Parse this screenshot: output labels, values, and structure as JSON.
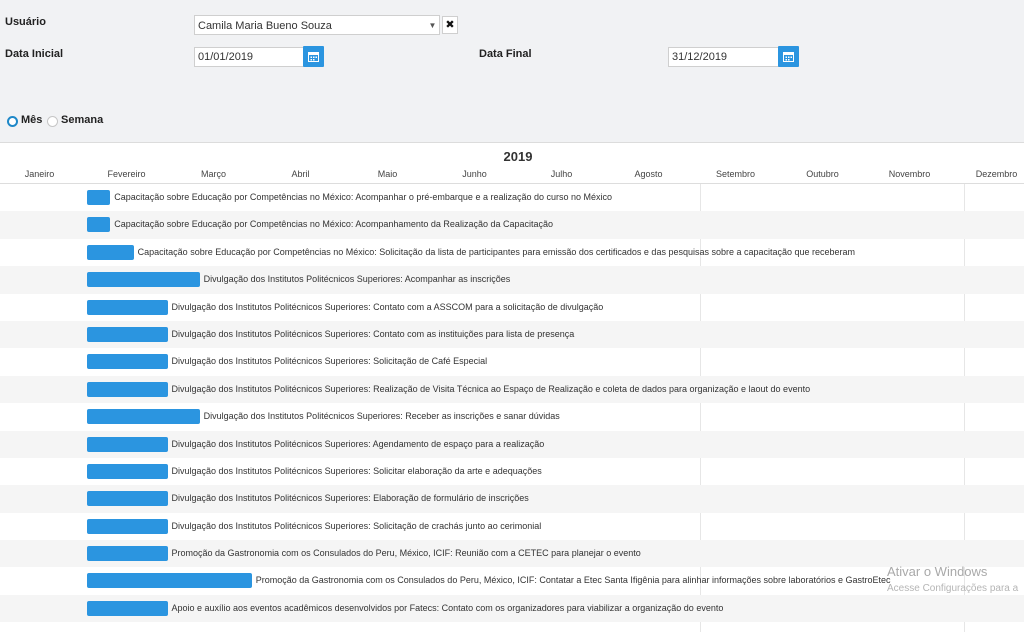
{
  "filters": {
    "usuario_label": "Usuário",
    "usuario_value": "Camila Maria Bueno Souza",
    "data_inicial_label": "Data Inicial",
    "data_inicial_value": "01/01/2019",
    "data_final_label": "Data Final",
    "data_final_value": "31/12/2019",
    "clear_glyph": "✖",
    "dropdown_glyph": "▼"
  },
  "view_toggle": {
    "options": [
      {
        "label": "Mês",
        "selected": true
      },
      {
        "label": "Semana",
        "selected": false
      }
    ]
  },
  "timeline": {
    "year": "2019",
    "months": [
      "Janeiro",
      "Fevereiro",
      "Março",
      "Abril",
      "Maio",
      "Junho",
      "Julho",
      "Agosto",
      "Setembro",
      "Outubro",
      "Novembro",
      "Dezembro"
    ]
  },
  "accent_color": "#2b95e0",
  "tasks": [
    {
      "label": "Capacitação sobre Educação por Competências no México: Acompanhar o pré-embarque e a realização do curso no México",
      "start": "2019-02",
      "duration_months": 0.27
    },
    {
      "label": "Capacitação sobre Educação por Competências no México: Acompanhamento da Realização da Capacitação",
      "start": "2019-02",
      "duration_months": 0.27
    },
    {
      "label": "Capacitação sobre Educação por Competências no México: Solicitação da lista de participantes para emissão dos certificados e das pesquisas sobre a capacitação que receberam",
      "start": "2019-02",
      "duration_months": 0.54
    },
    {
      "label": "Divulgação dos Institutos Politécnicos Superiores: Acompanhar as inscrições",
      "start": "2019-02",
      "duration_months": 1.3
    },
    {
      "label": "Divulgação dos Institutos Politécnicos Superiores: Contato com a ASSCOM para a solicitação de divulgação",
      "start": "2019-02",
      "duration_months": 0.93
    },
    {
      "label": "Divulgação dos Institutos Politécnicos Superiores: Contato com as instituições para lista de presença",
      "start": "2019-02",
      "duration_months": 0.93
    },
    {
      "label": "Divulgação dos Institutos Politécnicos Superiores: Solicitação de Café Especial",
      "start": "2019-02",
      "duration_months": 0.93
    },
    {
      "label": "Divulgação dos Institutos Politécnicos Superiores: Realização de Visita Técnica ao Espaço de Realização e coleta de dados para organização e laout do evento",
      "start": "2019-02",
      "duration_months": 0.93
    },
    {
      "label": "Divulgação dos Institutos Politécnicos Superiores: Receber as inscrições e sanar dúvidas",
      "start": "2019-02",
      "duration_months": 1.3
    },
    {
      "label": "Divulgação dos Institutos Politécnicos Superiores: Agendamento de espaço para a realização",
      "start": "2019-02",
      "duration_months": 0.93
    },
    {
      "label": "Divulgação dos Institutos Politécnicos Superiores: Solicitar elaboração da arte e adequações",
      "start": "2019-02",
      "duration_months": 0.93
    },
    {
      "label": "Divulgação dos Institutos Politécnicos Superiores: Elaboração de formulário de inscrições",
      "start": "2019-02",
      "duration_months": 0.93
    },
    {
      "label": "Divulgação dos Institutos Politécnicos Superiores: Solicitação de crachás junto ao cerimonial",
      "start": "2019-02",
      "duration_months": 0.93
    },
    {
      "label": "Promoção da Gastronomia com os Consulados do Peru, México, ICIF: Reunião com a CETEC para planejar o evento",
      "start": "2019-02",
      "duration_months": 0.93
    },
    {
      "label": "Promoção da Gastronomia com os Consulados do Peru, México, ICIF: Contatar a Etec Santa Ifigênia para alinhar informações sobre laboratórios e GastroEtec",
      "start": "2019-02",
      "duration_months": 1.9
    },
    {
      "label": "Apoio e auxílio aos eventos acadêmicos desenvolvidos por Fatecs: Contato com os organizadores para viabilizar a organização do evento",
      "start": "2019-02",
      "duration_months": 0.93
    }
  ],
  "watermark": {
    "title": "Ativar o Windows",
    "subtitle": "Acesse Configurações para a"
  }
}
